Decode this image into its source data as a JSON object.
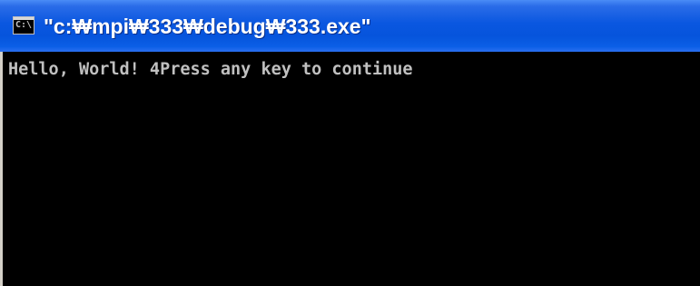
{
  "window": {
    "title": "\"c:₩mpi₩333₩debug₩333.exe\"",
    "icon": "console-window-icon",
    "icon_label": "C:\\"
  },
  "console": {
    "output": "Hello, World! 4Press any key to continue"
  },
  "colors": {
    "titlebar": "#0a57e0",
    "console_background": "#000000",
    "console_text": "#c0c0c0"
  }
}
